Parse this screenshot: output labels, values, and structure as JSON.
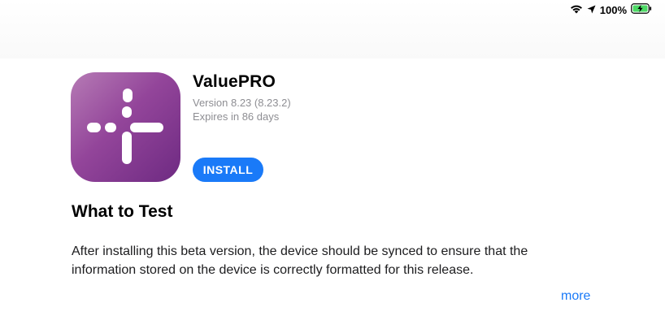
{
  "status_bar": {
    "battery_percent": "100%",
    "wifi_icon": "wifi-icon",
    "location_icon": "location-arrow-icon",
    "battery_icon": "battery-charging-icon"
  },
  "app": {
    "name": "ValuePRO",
    "version": "Version 8.23 (8.23.2)",
    "expires": "Expires in 86 days",
    "install_label": "INSTALL",
    "icon_name": "valuepro-app-icon"
  },
  "what_to_test": {
    "title": "What to Test",
    "line1": "After installing this beta version, the device should be synced to ensure that the",
    "line2": "information stored on the device is correctly formatted for this release.",
    "more_label": "more"
  },
  "colors": {
    "accent": "#1a7af8",
    "icon_gradient_start": "#b67bb5",
    "icon_gradient_end": "#6e2a82",
    "secondary_text": "#8e8e93"
  }
}
